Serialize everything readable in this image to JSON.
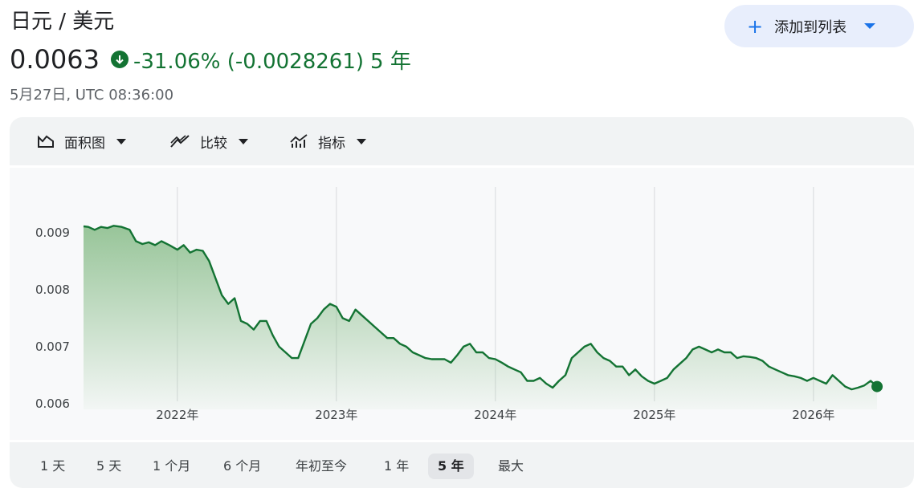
{
  "header": {
    "pair": "日元 / 美元",
    "add_button_label": "添加到列表",
    "price": "0.0063",
    "change": "-31.06% (-0.0028261)",
    "period": "5 年",
    "timestamp": "5月27日, UTC 08:36:00"
  },
  "toolbar": {
    "chart_type_label": "面积图",
    "compare_label": "比较",
    "indicators_label": "指标"
  },
  "ranges": [
    "1 天",
    "5 天",
    "1 个月",
    "6 个月",
    "年初至今",
    "1 年",
    "5 年",
    "最大"
  ],
  "active_range": "5 年",
  "colors": {
    "line": "#137333",
    "fill_top": "#8dbf8e",
    "negative": "#137333",
    "accent": "#1a73e8"
  },
  "chart_data": {
    "type": "area",
    "x_ticks": [
      "2022年",
      "2023年",
      "2024年",
      "2025年",
      "2026年"
    ],
    "y_ticks": [
      0.006,
      0.007,
      0.008,
      0.009
    ],
    "y_tick_labels": [
      "0.006",
      "0.007",
      "0.008",
      "0.009"
    ],
    "ylim": [
      0.0059,
      0.0098
    ],
    "xlim": [
      2021.41,
      2026.42
    ],
    "grid": "vertical",
    "series": [
      {
        "x": [
          2021.41,
          2021.44,
          2021.48,
          2021.52,
          2021.56,
          2021.6,
          2021.65,
          2021.7,
          2021.74,
          2021.78,
          2021.82,
          2021.86,
          2021.9,
          2021.95,
          2022.0,
          2022.04,
          2022.08,
          2022.12,
          2022.16,
          2022.2,
          2022.24,
          2022.28,
          2022.32,
          2022.36,
          2022.4,
          2022.44,
          2022.48,
          2022.52,
          2022.56,
          2022.6,
          2022.64,
          2022.68,
          2022.72,
          2022.76,
          2022.8,
          2022.84,
          2022.88,
          2022.92,
          2022.96,
          2023.0,
          2023.04,
          2023.08,
          2023.12,
          2023.16,
          2023.2,
          2023.24,
          2023.28,
          2023.32,
          2023.36,
          2023.4,
          2023.44,
          2023.48,
          2023.52,
          2023.56,
          2023.6,
          2023.64,
          2023.68,
          2023.72,
          2023.76,
          2023.8,
          2023.84,
          2023.88,
          2023.92,
          2023.96,
          2024.0,
          2024.04,
          2024.08,
          2024.12,
          2024.16,
          2024.2,
          2024.24,
          2024.28,
          2024.32,
          2024.36,
          2024.4,
          2024.44,
          2024.48,
          2024.52,
          2024.56,
          2024.6,
          2024.64,
          2024.68,
          2024.72,
          2024.76,
          2024.8,
          2024.84,
          2024.88,
          2024.92,
          2024.96,
          2025.0,
          2025.04,
          2025.08,
          2025.12,
          2025.16,
          2025.2,
          2025.24,
          2025.28,
          2025.32,
          2025.36,
          2025.4,
          2025.44,
          2025.48,
          2025.52,
          2025.56,
          2025.6,
          2025.64,
          2025.68,
          2025.72,
          2025.76,
          2025.8,
          2025.84,
          2025.88,
          2025.92,
          2025.96,
          2026.0,
          2026.04,
          2026.08,
          2026.12,
          2026.16,
          2026.2,
          2026.24,
          2026.28,
          2026.32,
          2026.36,
          2026.4
        ],
        "y": [
          0.00911,
          0.0091,
          0.00905,
          0.0091,
          0.00908,
          0.00912,
          0.0091,
          0.00905,
          0.00885,
          0.0088,
          0.00883,
          0.00878,
          0.00885,
          0.00878,
          0.0087,
          0.00878,
          0.00865,
          0.0087,
          0.00868,
          0.0085,
          0.0082,
          0.0079,
          0.00775,
          0.00785,
          0.00745,
          0.0074,
          0.0073,
          0.00745,
          0.00745,
          0.0072,
          0.007,
          0.0069,
          0.0068,
          0.0068,
          0.0071,
          0.0074,
          0.0075,
          0.00765,
          0.00775,
          0.0077,
          0.0075,
          0.00745,
          0.00765,
          0.00755,
          0.00745,
          0.00735,
          0.00725,
          0.00715,
          0.00715,
          0.00705,
          0.007,
          0.0069,
          0.00685,
          0.0068,
          0.00678,
          0.00678,
          0.00678,
          0.00672,
          0.00685,
          0.007,
          0.00705,
          0.0069,
          0.0069,
          0.0068,
          0.00678,
          0.00672,
          0.00665,
          0.0066,
          0.00655,
          0.0064,
          0.0064,
          0.00645,
          0.00635,
          0.00628,
          0.0064,
          0.0065,
          0.0068,
          0.0069,
          0.007,
          0.00705,
          0.0069,
          0.0068,
          0.00675,
          0.00665,
          0.00665,
          0.0065,
          0.0066,
          0.00648,
          0.0064,
          0.00635,
          0.0064,
          0.00645,
          0.0066,
          0.0067,
          0.0068,
          0.00695,
          0.007,
          0.00695,
          0.0069,
          0.00695,
          0.0069,
          0.0069,
          0.0068,
          0.00683,
          0.00682,
          0.0068,
          0.00675,
          0.00665,
          0.0066,
          0.00655,
          0.0065,
          0.00648,
          0.00645,
          0.0064,
          0.00645,
          0.0064,
          0.00635,
          0.0065,
          0.0064,
          0.0063,
          0.00625,
          0.00628,
          0.00632,
          0.0064,
          0.0063
        ]
      }
    ],
    "last_point": {
      "x": 2026.4,
      "y": 0.0063
    }
  }
}
